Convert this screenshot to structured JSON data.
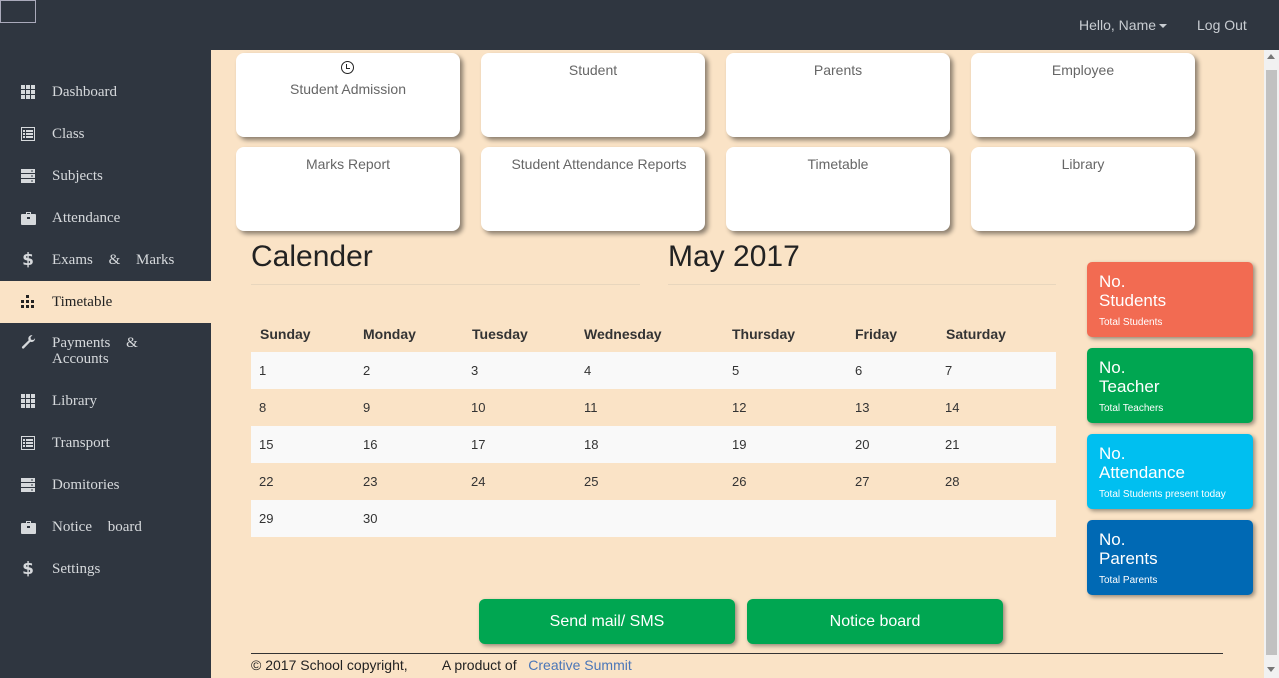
{
  "header": {
    "greeting": "Hello, Name",
    "logout": "Log Out"
  },
  "sidebar": {
    "items": [
      {
        "label": "Dashboard",
        "icon": "grid-icon"
      },
      {
        "label": "Class",
        "icon": "list-icon"
      },
      {
        "label": "Subjects",
        "icon": "stack-icon"
      },
      {
        "label": "Attendance",
        "icon": "briefcase-icon"
      },
      {
        "label": "Exams & Marks",
        "icon": "dollar-icon"
      },
      {
        "label": "Timetable",
        "icon": "bars-icon",
        "active": true
      },
      {
        "label": "Payments & Accounts",
        "icon": "wrench-icon"
      },
      {
        "label": "Library",
        "icon": "grid-icon"
      },
      {
        "label": "Transport",
        "icon": "list-icon"
      },
      {
        "label": "Domitories",
        "icon": "stack-icon"
      },
      {
        "label": "Notice board",
        "icon": "briefcase-icon"
      },
      {
        "label": "Settings",
        "icon": "dollar-icon"
      }
    ]
  },
  "tiles": [
    {
      "label": "Student Admission",
      "icon": "clock-icon"
    },
    {
      "label": "Student"
    },
    {
      "label": "Parents"
    },
    {
      "label": "Employee"
    },
    {
      "label": "Marks Report"
    },
    {
      "label": "Student Attendance Reports"
    },
    {
      "label": "Timetable"
    },
    {
      "label": "Library"
    }
  ],
  "calendar": {
    "title": "Calender",
    "month": "May 2017",
    "days": [
      "Sunday",
      "Monday",
      "Tuesday",
      "Wednesday",
      "Thursday",
      "Friday",
      "Saturday"
    ],
    "weeks": [
      [
        "1",
        "2",
        "3",
        "4",
        "5",
        "6",
        "7"
      ],
      [
        "8",
        "9",
        "10",
        "11",
        "12",
        "13",
        "14"
      ],
      [
        "15",
        "16",
        "17",
        "18",
        "19",
        "20",
        "21"
      ],
      [
        "22",
        "23",
        "24",
        "25",
        "26",
        "27",
        "28"
      ],
      [
        "29",
        "30",
        "",
        "",
        "",
        "",
        ""
      ]
    ]
  },
  "stats": [
    {
      "line1": "No.",
      "line2": "Students",
      "caption": "Total Students",
      "color": "#f26b52"
    },
    {
      "line1": "No.",
      "line2": "Teacher",
      "caption": "Total Teachers",
      "color": "#00a651"
    },
    {
      "line1": "No.",
      "line2": "Attendance",
      "caption": "Total Students present today",
      "color": "#00bff0"
    },
    {
      "line1": "No.",
      "line2": "Parents",
      "caption": "Total Parents",
      "color": "#0069b4"
    }
  ],
  "actions": {
    "send": "Send mail/ SMS",
    "notice": "Notice board"
  },
  "footer": {
    "copyright": "© 2017 School copyright,",
    "product": "A product of",
    "company": "Creative Summit"
  }
}
